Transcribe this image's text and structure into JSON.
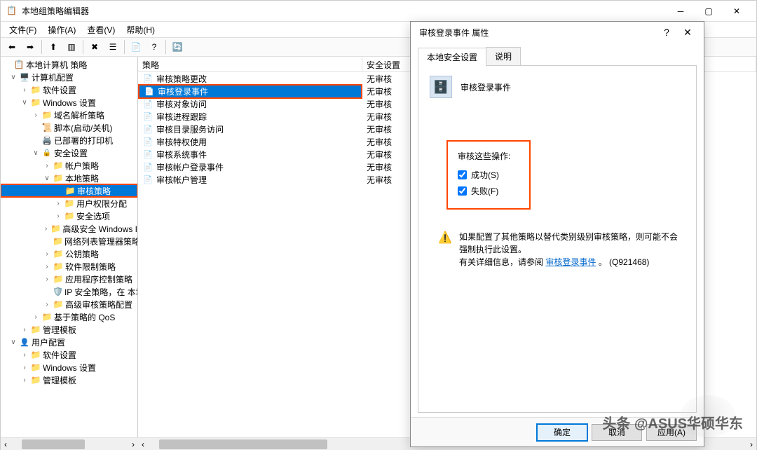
{
  "window": {
    "title": "本地组策略编辑器"
  },
  "menu": {
    "file": "文件(F)",
    "action": "操作(A)",
    "view": "查看(V)",
    "help": "帮助(H)"
  },
  "tree": {
    "root": "本地计算机 策略",
    "computer_cfg": "计算机配置",
    "software_settings": "软件设置",
    "windows_settings": "Windows 设置",
    "name_resolution": "域名解析策略",
    "scripts": "脚本(启动/关机)",
    "deployed_printers": "已部署的打印机",
    "security_settings": "安全设置",
    "account_policies": "帐户策略",
    "local_policies": "本地策略",
    "audit_policy": "审核策略",
    "user_rights": "用户权限分配",
    "security_options": "安全选项",
    "adv_windows_fw": "高级安全 Windows I",
    "network_list": "网络列表管理器策略",
    "public_key": "公钥策略",
    "software_restriction": "软件限制策略",
    "app_control": "应用程序控制策略",
    "ip_security": "IP 安全策略，在 本地",
    "adv_audit": "高级审核策略配置",
    "qos": "基于策略的 QoS",
    "admin_templates_c": "管理模板",
    "user_cfg": "用户配置",
    "software_settings_u": "软件设置",
    "windows_settings_u": "Windows 设置",
    "admin_templates_u": "管理模板"
  },
  "list": {
    "col_policy": "策略",
    "col_setting": "安全设置",
    "rows": [
      {
        "name": "审核策略更改",
        "setting": "无审核"
      },
      {
        "name": "审核登录事件",
        "setting": "无审核"
      },
      {
        "name": "审核对象访问",
        "setting": "无审核"
      },
      {
        "name": "审核进程跟踪",
        "setting": "无审核"
      },
      {
        "name": "审核目录服务访问",
        "setting": "无审核"
      },
      {
        "name": "审核特权使用",
        "setting": "无审核"
      },
      {
        "name": "审核系统事件",
        "setting": "无审核"
      },
      {
        "name": "审核帐户登录事件",
        "setting": "无审核"
      },
      {
        "name": "审核帐户管理",
        "setting": "无审核"
      }
    ]
  },
  "dialog": {
    "title": "审核登录事件 属性",
    "tab_security": "本地安全设置",
    "tab_explain": "说明",
    "policy_name": "审核登录事件",
    "audit_label": "审核这些操作:",
    "success": "成功(S)",
    "failure": "失败(F)",
    "note_line1": "如果配置了其他策略以替代类别级别审核策略，则可能不会强制执行此设置。",
    "note_line2a": "有关详细信息，请参阅",
    "note_link": "审核登录事件",
    "note_line2b": "。 (Q921468)",
    "btn_ok": "确定",
    "btn_cancel": "取消",
    "btn_apply": "应用(A)"
  },
  "watermark": "头条 @ASUS华硕华东"
}
